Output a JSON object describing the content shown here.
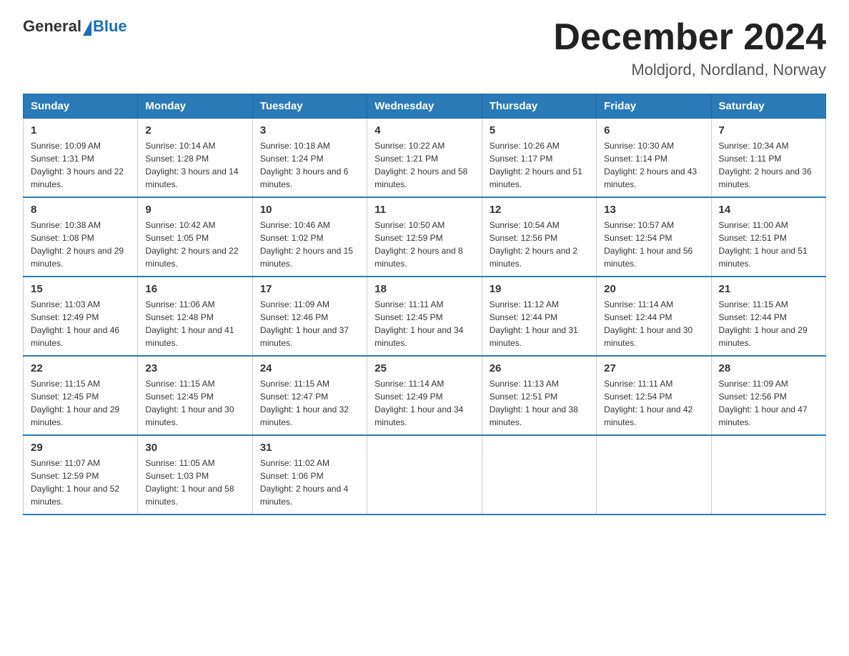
{
  "header": {
    "logo_general": "General",
    "logo_blue": "Blue",
    "month_year": "December 2024",
    "location": "Moldjord, Nordland, Norway"
  },
  "days_of_week": [
    "Sunday",
    "Monday",
    "Tuesday",
    "Wednesday",
    "Thursday",
    "Friday",
    "Saturday"
  ],
  "weeks": [
    [
      {
        "day": "1",
        "sunrise": "10:09 AM",
        "sunset": "1:31 PM",
        "daylight": "3 hours and 22 minutes."
      },
      {
        "day": "2",
        "sunrise": "10:14 AM",
        "sunset": "1:28 PM",
        "daylight": "3 hours and 14 minutes."
      },
      {
        "day": "3",
        "sunrise": "10:18 AM",
        "sunset": "1:24 PM",
        "daylight": "3 hours and 6 minutes."
      },
      {
        "day": "4",
        "sunrise": "10:22 AM",
        "sunset": "1:21 PM",
        "daylight": "2 hours and 58 minutes."
      },
      {
        "day": "5",
        "sunrise": "10:26 AM",
        "sunset": "1:17 PM",
        "daylight": "2 hours and 51 minutes."
      },
      {
        "day": "6",
        "sunrise": "10:30 AM",
        "sunset": "1:14 PM",
        "daylight": "2 hours and 43 minutes."
      },
      {
        "day": "7",
        "sunrise": "10:34 AM",
        "sunset": "1:11 PM",
        "daylight": "2 hours and 36 minutes."
      }
    ],
    [
      {
        "day": "8",
        "sunrise": "10:38 AM",
        "sunset": "1:08 PM",
        "daylight": "2 hours and 29 minutes."
      },
      {
        "day": "9",
        "sunrise": "10:42 AM",
        "sunset": "1:05 PM",
        "daylight": "2 hours and 22 minutes."
      },
      {
        "day": "10",
        "sunrise": "10:46 AM",
        "sunset": "1:02 PM",
        "daylight": "2 hours and 15 minutes."
      },
      {
        "day": "11",
        "sunrise": "10:50 AM",
        "sunset": "12:59 PM",
        "daylight": "2 hours and 8 minutes."
      },
      {
        "day": "12",
        "sunrise": "10:54 AM",
        "sunset": "12:56 PM",
        "daylight": "2 hours and 2 minutes."
      },
      {
        "day": "13",
        "sunrise": "10:57 AM",
        "sunset": "12:54 PM",
        "daylight": "1 hour and 56 minutes."
      },
      {
        "day": "14",
        "sunrise": "11:00 AM",
        "sunset": "12:51 PM",
        "daylight": "1 hour and 51 minutes."
      }
    ],
    [
      {
        "day": "15",
        "sunrise": "11:03 AM",
        "sunset": "12:49 PM",
        "daylight": "1 hour and 46 minutes."
      },
      {
        "day": "16",
        "sunrise": "11:06 AM",
        "sunset": "12:48 PM",
        "daylight": "1 hour and 41 minutes."
      },
      {
        "day": "17",
        "sunrise": "11:09 AM",
        "sunset": "12:46 PM",
        "daylight": "1 hour and 37 minutes."
      },
      {
        "day": "18",
        "sunrise": "11:11 AM",
        "sunset": "12:45 PM",
        "daylight": "1 hour and 34 minutes."
      },
      {
        "day": "19",
        "sunrise": "11:12 AM",
        "sunset": "12:44 PM",
        "daylight": "1 hour and 31 minutes."
      },
      {
        "day": "20",
        "sunrise": "11:14 AM",
        "sunset": "12:44 PM",
        "daylight": "1 hour and 30 minutes."
      },
      {
        "day": "21",
        "sunrise": "11:15 AM",
        "sunset": "12:44 PM",
        "daylight": "1 hour and 29 minutes."
      }
    ],
    [
      {
        "day": "22",
        "sunrise": "11:15 AM",
        "sunset": "12:45 PM",
        "daylight": "1 hour and 29 minutes."
      },
      {
        "day": "23",
        "sunrise": "11:15 AM",
        "sunset": "12:45 PM",
        "daylight": "1 hour and 30 minutes."
      },
      {
        "day": "24",
        "sunrise": "11:15 AM",
        "sunset": "12:47 PM",
        "daylight": "1 hour and 32 minutes."
      },
      {
        "day": "25",
        "sunrise": "11:14 AM",
        "sunset": "12:49 PM",
        "daylight": "1 hour and 34 minutes."
      },
      {
        "day": "26",
        "sunrise": "11:13 AM",
        "sunset": "12:51 PM",
        "daylight": "1 hour and 38 minutes."
      },
      {
        "day": "27",
        "sunrise": "11:11 AM",
        "sunset": "12:54 PM",
        "daylight": "1 hour and 42 minutes."
      },
      {
        "day": "28",
        "sunrise": "11:09 AM",
        "sunset": "12:56 PM",
        "daylight": "1 hour and 47 minutes."
      }
    ],
    [
      {
        "day": "29",
        "sunrise": "11:07 AM",
        "sunset": "12:59 PM",
        "daylight": "1 hour and 52 minutes."
      },
      {
        "day": "30",
        "sunrise": "11:05 AM",
        "sunset": "1:03 PM",
        "daylight": "1 hour and 58 minutes."
      },
      {
        "day": "31",
        "sunrise": "11:02 AM",
        "sunset": "1:06 PM",
        "daylight": "2 hours and 4 minutes."
      },
      null,
      null,
      null,
      null
    ]
  ]
}
